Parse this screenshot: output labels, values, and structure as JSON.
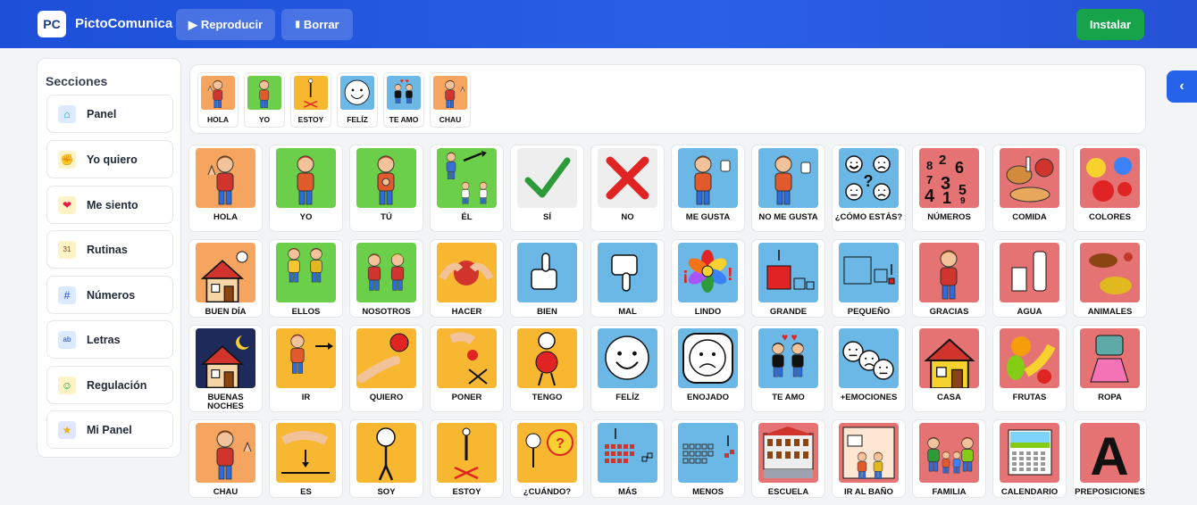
{
  "header": {
    "logo_text": "PC",
    "app_title": "PictoComunica",
    "play_label": "Reproducir",
    "play_icon": "▶",
    "clear_label": "Borrar",
    "clear_icon": "▮",
    "install_label": "Instalar"
  },
  "sidebar": {
    "title": "Secciones",
    "items": [
      {
        "label": "Panel",
        "icon": "home-icon",
        "color": "#dbeafe"
      },
      {
        "label": "Yo quiero",
        "icon": "hands-icon",
        "color": "#fef3c7"
      },
      {
        "label": "Me siento",
        "icon": "heart-icon",
        "color": "#fef3c7"
      },
      {
        "label": "Rutinas",
        "icon": "calendar-icon",
        "color": "#fef3c7"
      },
      {
        "label": "Números",
        "icon": "numbers-icon",
        "color": "#dbeafe"
      },
      {
        "label": "Letras",
        "icon": "letters-icon",
        "color": "#dbeafe"
      },
      {
        "label": "Regulación",
        "icon": "person-icon",
        "color": "#fef3c7"
      },
      {
        "label": "Mi Panel",
        "icon": "star-icon",
        "color": "#e0e7ff"
      }
    ]
  },
  "sentence": {
    "items": [
      {
        "label": "HOLA",
        "bg": "#f6a560"
      },
      {
        "label": "YO",
        "bg": "#6ccf4a"
      },
      {
        "label": "ESTOY",
        "bg": "#f7b731"
      },
      {
        "label": "FELÍZ",
        "bg": "#6bb8e6"
      },
      {
        "label": "TE AMO",
        "bg": "#6bb8e6"
      },
      {
        "label": "CHAU",
        "bg": "#f6a560"
      }
    ]
  },
  "grid": [
    [
      {
        "label": "HOLA",
        "bg": "#f6a560",
        "icon": "person-waving-icon"
      },
      {
        "label": "YO",
        "bg": "#6ccf4a",
        "icon": "boy-icon"
      },
      {
        "label": "TÚ",
        "bg": "#6ccf4a",
        "icon": "boy-pointing-icon"
      },
      {
        "label": "ÉL",
        "bg": "#6ccf4a",
        "icon": "he-icon"
      },
      {
        "label": "SÍ",
        "bg": "#eeeeee",
        "icon": "check-icon"
      },
      {
        "label": "NO",
        "bg": "#eeeeee",
        "icon": "cross-icon"
      },
      {
        "label": "ME GUSTA",
        "bg": "#6bb8e6",
        "icon": "thumbs-up-person-icon"
      },
      {
        "label": "NO ME GUSTA",
        "bg": "#6bb8e6",
        "icon": "thumbs-down-person-icon"
      },
      {
        "label": "¿CÓMO ESTÁS?",
        "bg": "#6bb8e6",
        "icon": "faces-question-icon"
      },
      {
        "label": "NÚMEROS",
        "bg": "#e57373",
        "icon": "numbers-icon"
      },
      {
        "label": "COMIDA",
        "bg": "#e57373",
        "icon": "food-icon"
      },
      {
        "label": "COLORES",
        "bg": "#e57373",
        "icon": "paint-icon"
      }
    ],
    [
      {
        "label": "BUEN DÍA",
        "bg": "#f6a560",
        "icon": "house-sun-icon"
      },
      {
        "label": "ELLOS",
        "bg": "#6ccf4a",
        "icon": "they-icon"
      },
      {
        "label": "NOSOTROS",
        "bg": "#6ccf4a",
        "icon": "we-icon"
      },
      {
        "label": "HACER",
        "bg": "#f7b731",
        "icon": "hands-ball-icon"
      },
      {
        "label": "BIEN",
        "bg": "#6bb8e6",
        "icon": "thumb-up-icon"
      },
      {
        "label": "MAL",
        "bg": "#6bb8e6",
        "icon": "thumb-down-icon"
      },
      {
        "label": "LINDO",
        "bg": "#6bb8e6",
        "icon": "flower-icon"
      },
      {
        "label": "GRANDE",
        "bg": "#6bb8e6",
        "icon": "big-square-icon"
      },
      {
        "label": "PEQUEÑO",
        "bg": "#6bb8e6",
        "icon": "small-square-icon"
      },
      {
        "label": "GRACIAS",
        "bg": "#e57373",
        "icon": "thanks-icon"
      },
      {
        "label": "AGUA",
        "bg": "#e57373",
        "icon": "water-icon"
      },
      {
        "label": "ANIMALES",
        "bg": "#e57373",
        "icon": "animals-icon"
      }
    ],
    [
      {
        "label": "BUENAS NOCHES",
        "bg": "#f6a560",
        "icon": "house-moon-icon"
      },
      {
        "label": "IR",
        "bg": "#f7b731",
        "icon": "walk-icon"
      },
      {
        "label": "QUIERO",
        "bg": "#f7b731",
        "icon": "want-icon"
      },
      {
        "label": "PONER",
        "bg": "#f7b731",
        "icon": "put-icon"
      },
      {
        "label": "TENGO",
        "bg": "#f7b731",
        "icon": "have-icon"
      },
      {
        "label": "FELÍZ",
        "bg": "#6bb8e6",
        "icon": "happy-face-icon"
      },
      {
        "label": "ENOJADO",
        "bg": "#6bb8e6",
        "icon": "angry-face-icon"
      },
      {
        "label": "TE AMO",
        "bg": "#6bb8e6",
        "icon": "love-icon"
      },
      {
        "label": "+EMOCIONES",
        "bg": "#6bb8e6",
        "icon": "emotions-icon"
      },
      {
        "label": "CASA",
        "bg": "#e57373",
        "icon": "house-icon"
      },
      {
        "label": "FRUTAS",
        "bg": "#e57373",
        "icon": "fruits-icon"
      },
      {
        "label": "ROPA",
        "bg": "#e57373",
        "icon": "clothes-icon"
      }
    ],
    [
      {
        "label": "CHAU",
        "bg": "#f6a560",
        "icon": "bye-icon"
      },
      {
        "label": "ES",
        "bg": "#f7b731",
        "icon": "is-icon"
      },
      {
        "label": "SOY",
        "bg": "#f7b731",
        "icon": "i-am-icon"
      },
      {
        "label": "ESTOY",
        "bg": "#f7b731",
        "icon": "stand-icon"
      },
      {
        "label": "¿CUÁNDO?",
        "bg": "#f7b731",
        "icon": "when-icon"
      },
      {
        "label": "MÁS",
        "bg": "#6bb8e6",
        "icon": "more-icon"
      },
      {
        "label": "MENOS",
        "bg": "#6bb8e6",
        "icon": "less-icon"
      },
      {
        "label": "ESCUELA",
        "bg": "#e57373",
        "icon": "school-icon"
      },
      {
        "label": "IR AL BAÑO",
        "bg": "#e57373",
        "icon": "toilet-icon"
      },
      {
        "label": "FAMILIA",
        "bg": "#e57373",
        "icon": "family-icon"
      },
      {
        "label": "CALENDARIO",
        "bg": "#e57373",
        "icon": "calendar-icon"
      },
      {
        "label": "PREPOSICIONES",
        "bg": "#e57373",
        "icon": "letter-a-icon"
      }
    ]
  ],
  "collapse_icon": "‹"
}
